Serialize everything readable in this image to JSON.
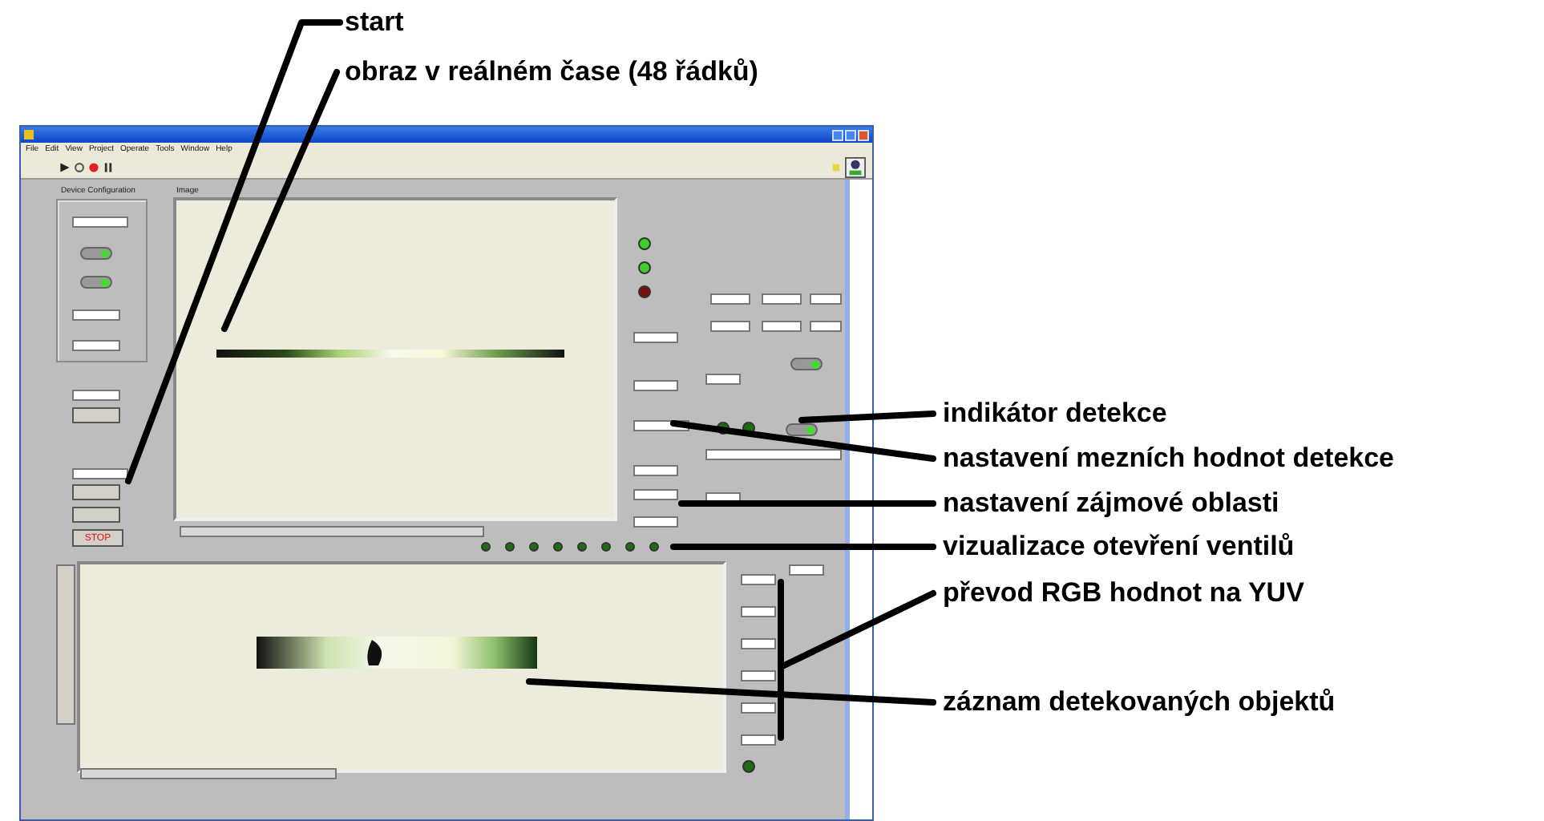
{
  "window": {
    "menu": [
      "File",
      "Edit",
      "View",
      "Project",
      "Operate",
      "Tools",
      "Window",
      "Help"
    ]
  },
  "panel": {
    "device_group": {
      "label": "Device Configuration",
      "switches": [
        {
          "on": true
        },
        {
          "on": true
        }
      ]
    },
    "image_label": "Image",
    "stop_button": "STOP",
    "status_leds": [
      {
        "color": "#3fcf2a"
      },
      {
        "color": "#3fcf2a"
      },
      {
        "color": "#7a1010"
      }
    ],
    "right_switches": [
      {
        "on": true
      },
      {
        "on": true
      }
    ],
    "detection_leds": [
      {
        "on": false
      },
      {
        "on": false
      }
    ],
    "valve_leds": [
      {
        "on": false
      },
      {
        "on": false
      },
      {
        "on": false
      },
      {
        "on": false
      },
      {
        "on": false
      },
      {
        "on": false
      },
      {
        "on": false
      },
      {
        "on": false
      }
    ],
    "record_led": {
      "on": false
    }
  },
  "annotations": [
    {
      "label": "start"
    },
    {
      "label": "obraz v reálném čase (48 řádků)"
    },
    {
      "label": "indikátor detekce"
    },
    {
      "label": "nastavení mezních hodnot detekce"
    },
    {
      "label": "nastavení zájmové oblasti"
    },
    {
      "label": "vizualizace otevření ventilů"
    },
    {
      "label": "převod RGB hodnot na YUV"
    },
    {
      "label": "záznam detekovaných objektů"
    }
  ]
}
